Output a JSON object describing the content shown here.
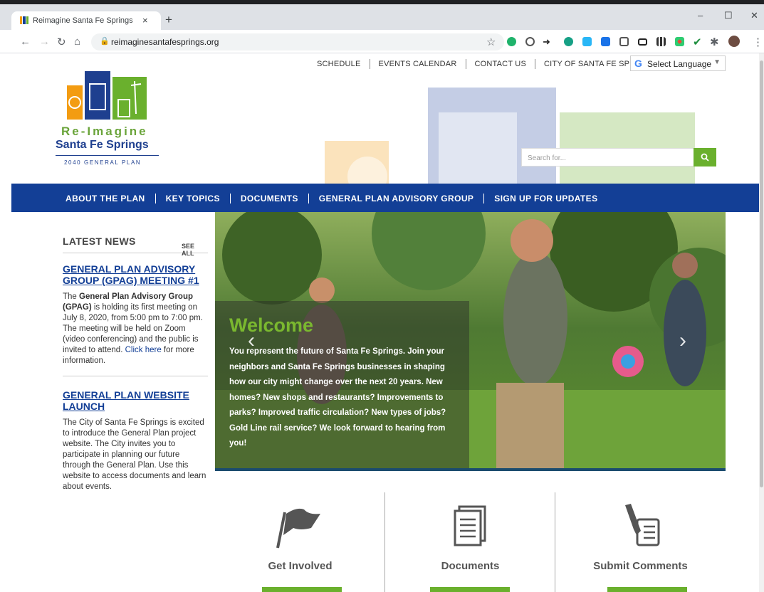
{
  "browser": {
    "tab_title": "Reimagine Santa Fe Springs",
    "tab_close": "×",
    "new_tab": "+",
    "url": "reimaginesantafesprings.org",
    "window": {
      "minimize": "–",
      "maximize": "☐",
      "close": "✕"
    }
  },
  "site": {
    "top_links": [
      "SCHEDULE",
      "EVENTS CALENDAR",
      "CONTACT US",
      "CITY OF SANTA FE SPRINGS"
    ],
    "language": {
      "label": "Select Language",
      "arrow": "▼"
    },
    "logo": {
      "line1": "Re-Imagine",
      "line2": "Santa Fe Springs",
      "line3": "2040 GENERAL PLAN"
    },
    "search": {
      "placeholder": "Search for..."
    },
    "main_nav": [
      "ABOUT THE PLAN",
      "KEY TOPICS",
      "DOCUMENTS",
      "GENERAL PLAN ADVISORY GROUP",
      "SIGN UP FOR UPDATES"
    ],
    "colors": {
      "nav_blue": "#133f96",
      "accent_green": "#6ab02d"
    }
  },
  "news": {
    "heading": "LATEST NEWS",
    "see_all": "SEE ALL",
    "items": [
      {
        "title": "GENERAL PLAN ADVISORY GROUP (GPAG) MEETING #1",
        "pre": "The ",
        "bold": "General Plan Advisory Group (GPAG)",
        "post": " is holding its first meeting on July 8, 2020, from 5:00 pm to 7:00 pm.  The meeting will be held on Zoom (video conferencing) and the public is invited to attend.  ",
        "link": "Click here",
        "tail": " for more information."
      },
      {
        "title": "GENERAL PLAN WEBSITE LAUNCH",
        "body": "The City of Santa Fe Springs is excited to introduce the General Plan project website.  The City invites you to participate in planning our future through the General Plan.  Use this website to access documents and learn about events."
      }
    ]
  },
  "slider": {
    "title": "Welcome",
    "text": "You represent the future of Santa Fe Springs.  Join your neighbors and Santa Fe Springs businesses in shaping how our city might change over the next 20 years.  New homes?  New shops and restaurants?  Improvements to parks?  Improved traffic circulation?  New types of jobs? Gold Line rail service?  We look forward to hearing from you!",
    "prev": "‹",
    "next": "›"
  },
  "cards": [
    {
      "label": "Get Involved",
      "icon": "flag-icon"
    },
    {
      "label": "Documents",
      "icon": "document-icon"
    },
    {
      "label": "Submit Comments",
      "icon": "pen-list-icon"
    }
  ]
}
